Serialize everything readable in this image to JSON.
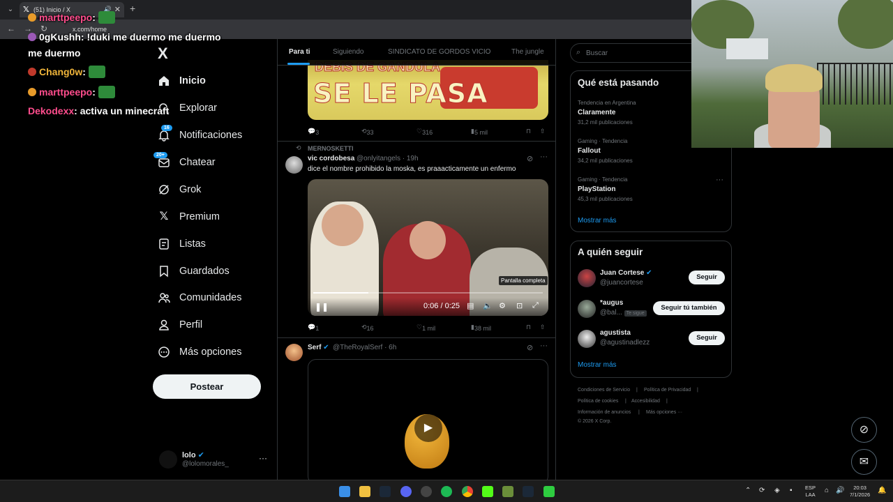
{
  "browser": {
    "tab_title": "(51) Inicio / X",
    "url": "x.com/home"
  },
  "chat": [
    {
      "user": "marttpeepo",
      "text": ""
    },
    {
      "user": "0gKushh",
      "text": "!duki me duermo me duermo"
    },
    {
      "user": "",
      "text": "me duermo"
    },
    {
      "user": "Chang0w",
      "text": ""
    },
    {
      "user": "marttpeepo",
      "text": ""
    },
    {
      "user": "Dekodexx",
      "text": "activa un minecraft"
    }
  ],
  "sidebar": {
    "logo": "X",
    "items": [
      {
        "label": "Inicio",
        "icon": "home-icon",
        "badge": ""
      },
      {
        "label": "Explorar",
        "icon": "search-icon",
        "badge": ""
      },
      {
        "label": "Notificaciones",
        "icon": "bell-icon",
        "badge": "16"
      },
      {
        "label": "Chatear",
        "icon": "mail-icon",
        "badge": "20+"
      },
      {
        "label": "Grok",
        "icon": "grok-icon",
        "badge": ""
      },
      {
        "label": "Premium",
        "icon": "x-icon",
        "badge": ""
      },
      {
        "label": "Listas",
        "icon": "list-icon",
        "badge": ""
      },
      {
        "label": "Guardados",
        "icon": "bookmark-icon",
        "badge": ""
      },
      {
        "label": "Comunidades",
        "icon": "people-icon",
        "badge": ""
      },
      {
        "label": "Perfil",
        "icon": "person-icon",
        "badge": ""
      },
      {
        "label": "Más opciones",
        "icon": "more-icon",
        "badge": ""
      }
    ],
    "post_button": "Postear",
    "account": {
      "name": "lolo",
      "handle": "@lolomorales_"
    }
  },
  "timeline": {
    "tabs": [
      "Para ti",
      "Siguiendo",
      "SINDICATO DE GORDOS VICIO",
      "The jungle"
    ],
    "active_tab": "Para ti",
    "posts": [
      {
        "image_text": "SE LE PASA",
        "image_text_top": "DEBIS DE GANDULA",
        "replies": "3",
        "reposts": "33",
        "likes": "316",
        "views": "5 mil"
      },
      {
        "reposted_by": "MERNOSKETTI",
        "name": "vic cordobesa",
        "handle": "@onlyitangels · 19h",
        "text": "dice el nombre prohibido la moska, es praaacticamente un enfermo",
        "video": {
          "time": "0:06 / 0:25",
          "progress": 0.24,
          "tooltip": "Pantalla completa"
        },
        "replies": "1",
        "reposts": "16",
        "likes": "1 mil",
        "views": "38 mil"
      },
      {
        "name": "Serf",
        "handle": "@TheRoyalSerf · 6h"
      }
    ]
  },
  "right": {
    "search_placeholder": "Buscar",
    "trends_title": "Qué está pasando",
    "trends": [
      {
        "category": "Tendencia en Argentina",
        "name": "Claramente",
        "count": "31,2 mil publicaciones"
      },
      {
        "category": "Gaming · Tendencia",
        "name": "Fallout",
        "count": "34,2 mil publicaciones"
      },
      {
        "category": "Gaming · Tendencia",
        "name": "PlayStation",
        "count": "45,3 mil publicaciones"
      }
    ],
    "trends_more": "Mostrar más",
    "follow_title": "A quién seguir",
    "follow": [
      {
        "name": "Juan Cortese",
        "handle": "@juancortese",
        "button": "Seguir",
        "tag": ""
      },
      {
        "name": "*augus",
        "handle": "@bal...",
        "button": "Seguir tú también",
        "tag": "Te sigue"
      },
      {
        "name": "agustista",
        "handle": "@agustinadlezz",
        "button": "Seguir",
        "tag": ""
      }
    ],
    "follow_more": "Mostrar más",
    "footer": [
      "Condiciones de Servicio",
      "Política de Privacidad",
      "Política de cookies",
      "Accesibilidad",
      "Información de anuncios",
      "Más opciones ···",
      "© 2026 X Corp."
    ]
  },
  "taskbar": {
    "lang_1": "ESP",
    "lang_2": "LAA",
    "time": "20:03",
    "date": "7/1/2026"
  },
  "colors": {
    "accent": "#1d9bf0",
    "background": "#000000",
    "text": "#e7e9ea",
    "muted": "#71767b"
  }
}
